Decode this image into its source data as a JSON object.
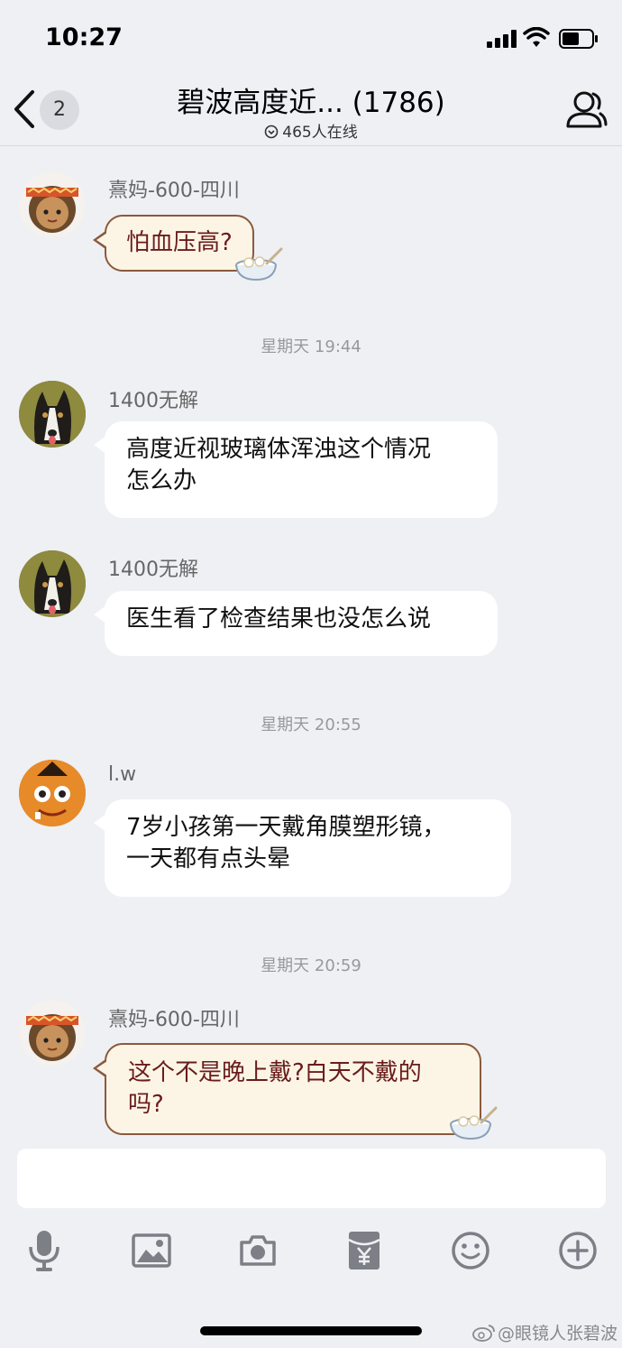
{
  "status_bar": {
    "time": "10:27"
  },
  "header": {
    "unread_count": "2",
    "title": "碧波高度近... (1786)",
    "online": "465人在线"
  },
  "messages": [
    {
      "sender": "熹妈-600-四川",
      "text": "怕血压高?",
      "style": "custom"
    },
    {
      "timestamp": "星期天 19:44"
    },
    {
      "sender": "1400无解",
      "text": "高度近视玻璃体浑浊这个情况怎么办",
      "line1": "高度近视玻璃体浑浊这个情况",
      "line2": "怎么办"
    },
    {
      "sender": "1400无解",
      "text": "医生看了检查结果也没怎么说"
    },
    {
      "timestamp": "星期天 20:55"
    },
    {
      "sender": "l.w",
      "line1": "7岁小孩第一天戴角膜塑形镜，",
      "line2": "一天都有点头晕"
    },
    {
      "timestamp": "星期天 20:59"
    },
    {
      "sender": "熹妈-600-四川",
      "line1": "这个不是晚上戴?白天不戴的",
      "line2": "吗?",
      "style": "custom"
    }
  ],
  "input": {
    "placeholder": ""
  },
  "toolbar": [
    "microphone-icon",
    "image-icon",
    "camera-icon",
    "red-packet-icon",
    "emoji-icon",
    "plus-icon"
  ],
  "watermark": "@眼镜人张碧波",
  "colors": {
    "background": "#eef0f4",
    "custom_bubble_bg": "#fcf5e6",
    "custom_bubble_border": "#8a5a3c",
    "custom_bubble_text": "#6a1c1c"
  }
}
